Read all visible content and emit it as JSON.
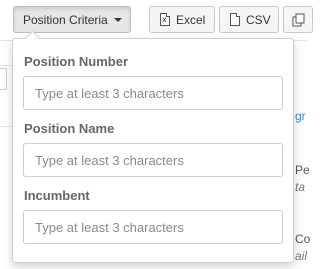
{
  "toolbar": {
    "criteria_label": "Position Criteria",
    "excel_label": "Excel",
    "csv_label": "CSV"
  },
  "background": {
    "frag_gr": "gr",
    "frag_pe": "Pe",
    "frag_ta": "ta",
    "frag_co": "Co",
    "frag_ail": "ail"
  },
  "criteria_panel": {
    "fields": [
      {
        "label": "Position Number",
        "value": "",
        "placeholder": "Type at least 3 characters"
      },
      {
        "label": "Position Name",
        "value": "",
        "placeholder": "Type at least 3 characters"
      },
      {
        "label": "Incumbent",
        "value": "",
        "placeholder": "Type at least 3 characters"
      }
    ]
  }
}
